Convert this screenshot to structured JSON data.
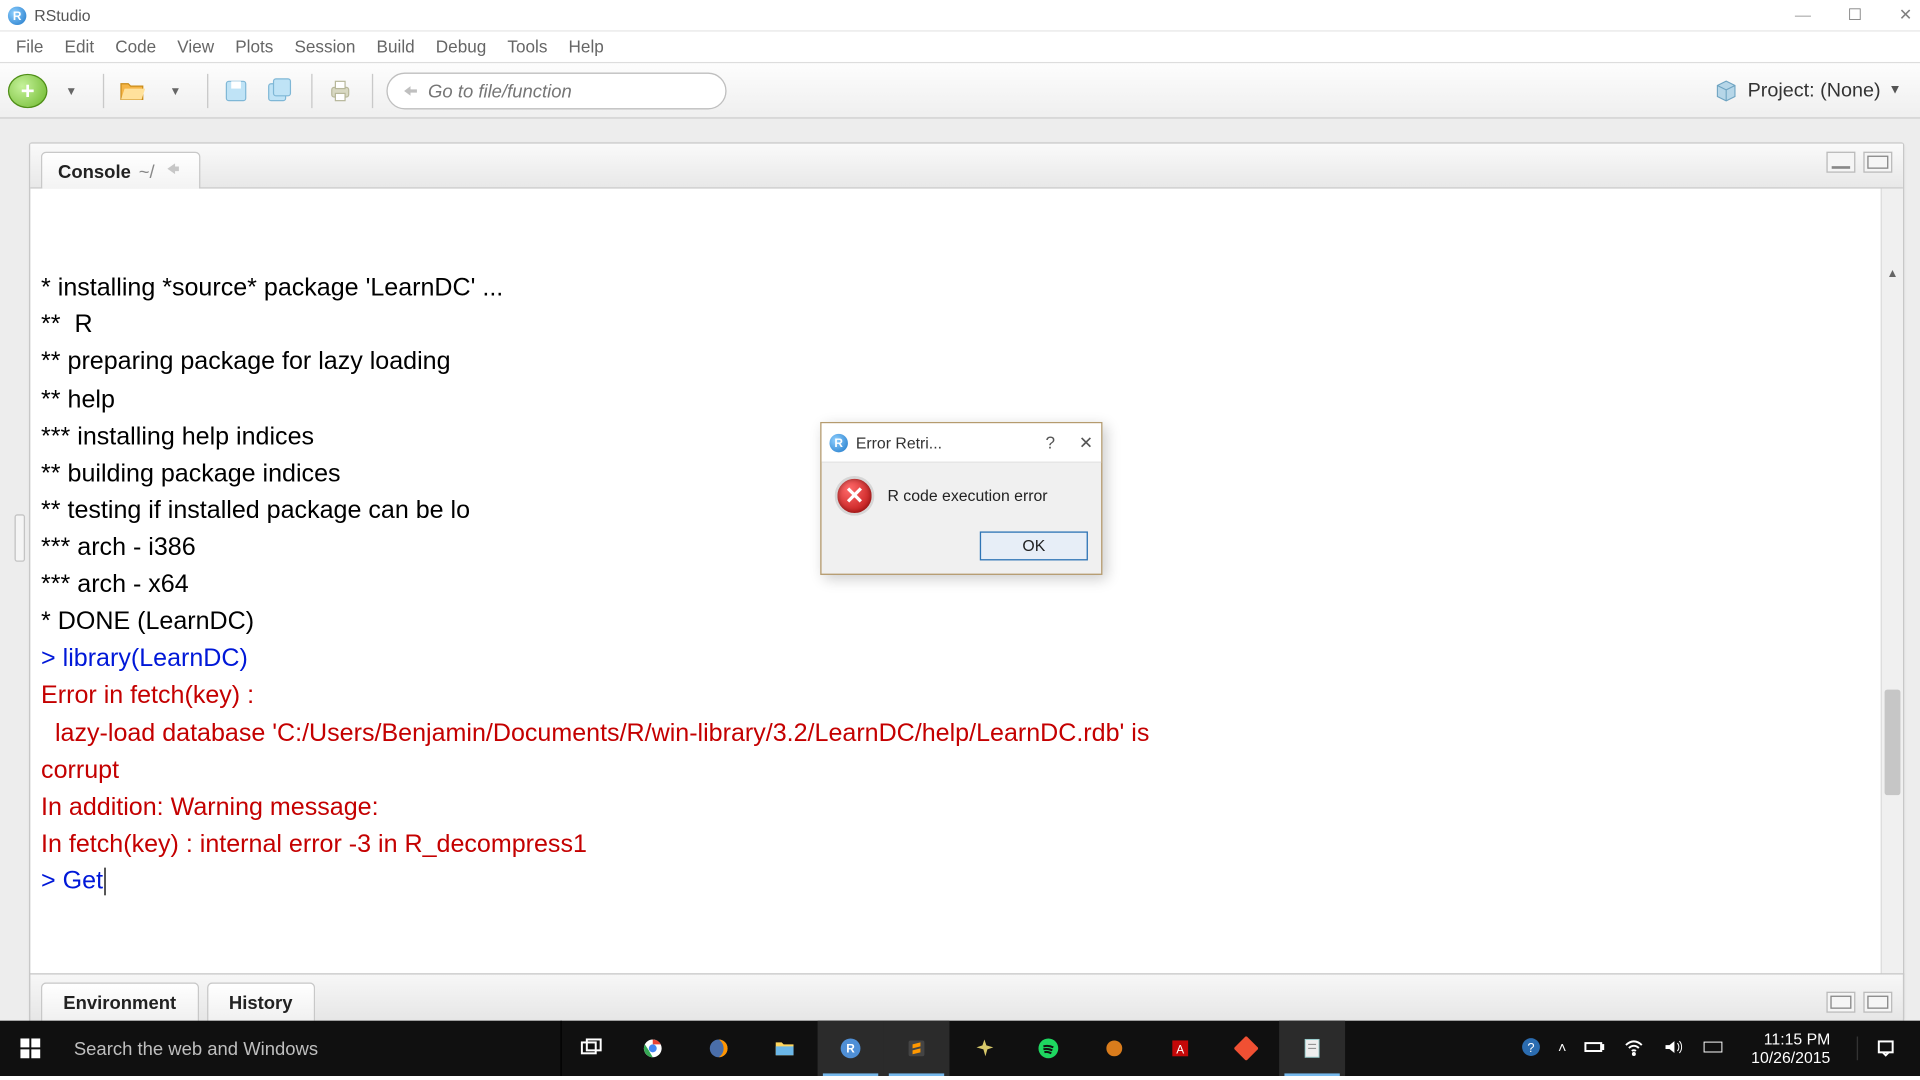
{
  "window": {
    "title": "RStudio"
  },
  "menu": [
    "File",
    "Edit",
    "Code",
    "View",
    "Plots",
    "Session",
    "Build",
    "Debug",
    "Tools",
    "Help"
  ],
  "toolbar": {
    "search_placeholder": "Go to file/function",
    "project_label": "Project: (None)"
  },
  "panel": {
    "tab_label": "Console",
    "tab_path": "~/"
  },
  "console_lines": [
    {
      "cls": "",
      "t": "* installing *source* package 'LearnDC' ..."
    },
    {
      "cls": "",
      "t": "**  R"
    },
    {
      "cls": "",
      "t": "** preparing package for lazy loading"
    },
    {
      "cls": "",
      "t": "** help"
    },
    {
      "cls": "",
      "t": "*** installing help indices"
    },
    {
      "cls": "",
      "t": "** building package indices"
    },
    {
      "cls": "",
      "t": "** testing if installed package can be lo"
    },
    {
      "cls": "",
      "t": "*** arch - i386"
    },
    {
      "cls": "",
      "t": "*** arch - x64"
    },
    {
      "cls": "",
      "t": "* DONE (LearnDC)"
    },
    {
      "cls": "blue",
      "t": "> library(LearnDC)"
    },
    {
      "cls": "red",
      "t": "Error in fetch(key) : "
    },
    {
      "cls": "red",
      "t": "  lazy-load database 'C:/Users/Benjamin/Documents/R/win-library/3.2/LearnDC/help/LearnDC.rdb' is"
    },
    {
      "cls": "red",
      "t": "corrupt"
    },
    {
      "cls": "red",
      "t": "In addition: Warning message:"
    },
    {
      "cls": "red",
      "t": "In fetch(key) : internal error -3 in R_decompress1"
    }
  ],
  "prompt": {
    "pre": "> ",
    "cmd": "Get"
  },
  "bottom_tabs": [
    "Environment",
    "History"
  ],
  "dialog": {
    "title": "Error Retri...",
    "message": "R code execution error",
    "ok": "OK"
  },
  "taskbar": {
    "search_placeholder": "Search the web and Windows",
    "time": "11:15 PM",
    "date": "10/26/2015"
  }
}
